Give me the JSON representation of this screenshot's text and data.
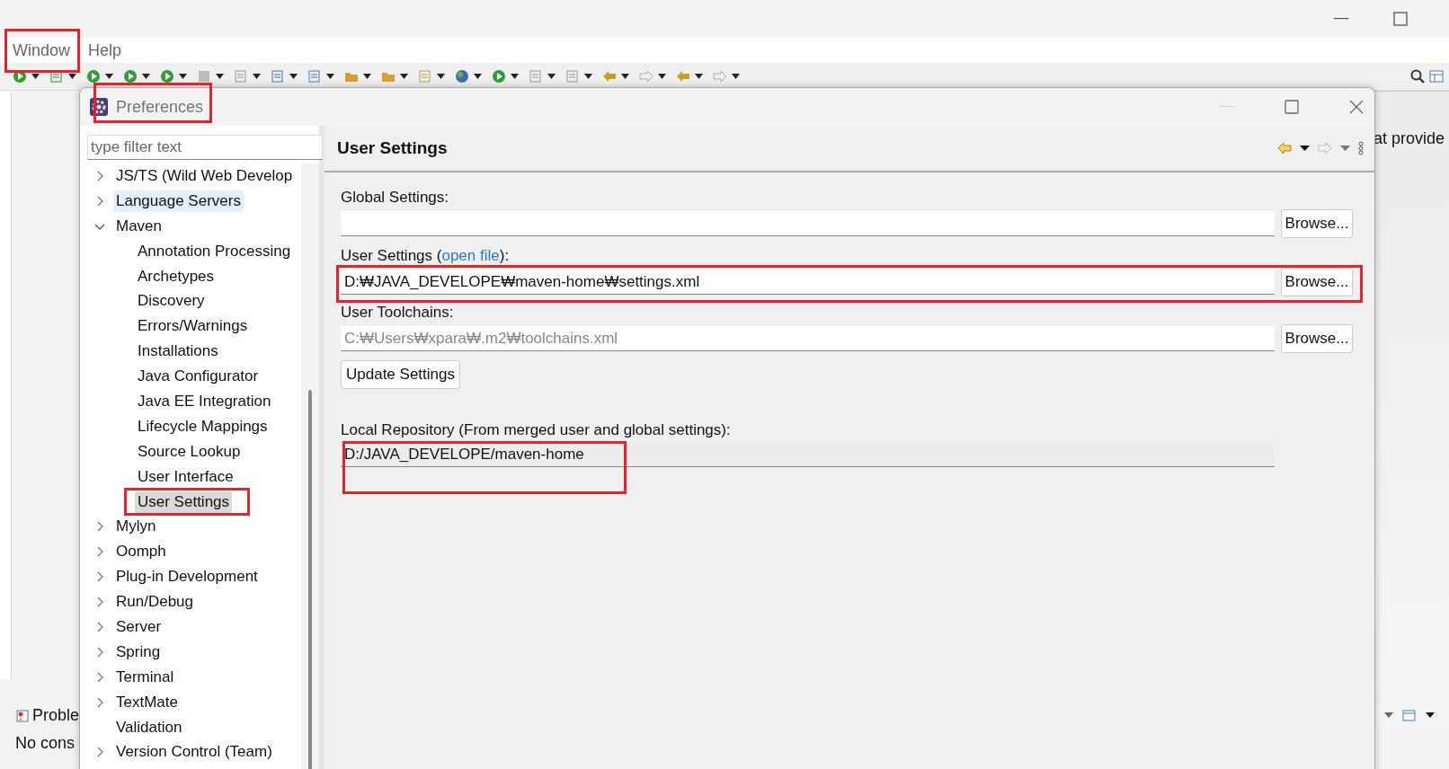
{
  "menu": [
    {
      "label": "Window"
    },
    {
      "label": "Help"
    }
  ],
  "background": {
    "right_text": "at provide",
    "problems_tab": "Proble",
    "console_text": "No cons"
  },
  "dialog": {
    "title": "Preferences",
    "filter": {
      "placeholder": "type filter text"
    },
    "tree": [
      {
        "label": "JS/TS (Wild Web Develop",
        "kind": "group",
        "expanded": false,
        "selected": false,
        "hovered": false
      },
      {
        "label": "Language Servers",
        "kind": "group",
        "expanded": false,
        "selected": false,
        "hovered": true
      },
      {
        "label": "Maven",
        "kind": "group",
        "expanded": true,
        "selected": false,
        "hovered": false,
        "children": [
          {
            "label": "Annotation Processing",
            "kind": "page",
            "selected": false,
            "hovered": false
          },
          {
            "label": "Archetypes",
            "kind": "page",
            "selected": false,
            "hovered": false
          },
          {
            "label": "Discovery",
            "kind": "page",
            "selected": false,
            "hovered": false
          },
          {
            "label": "Errors/Warnings",
            "kind": "page",
            "selected": false,
            "hovered": false
          },
          {
            "label": "Installations",
            "kind": "page",
            "selected": false,
            "hovered": false
          },
          {
            "label": "Java Configurator",
            "kind": "page",
            "selected": false,
            "hovered": false
          },
          {
            "label": "Java EE Integration",
            "kind": "page",
            "selected": false,
            "hovered": false
          },
          {
            "label": "Lifecycle Mappings",
            "kind": "page",
            "selected": false,
            "hovered": false
          },
          {
            "label": "Source Lookup",
            "kind": "page",
            "selected": false,
            "hovered": false
          },
          {
            "label": "User Interface",
            "kind": "page",
            "selected": false,
            "hovered": false
          },
          {
            "label": "User Settings",
            "kind": "page",
            "selected": true,
            "hovered": false
          }
        ]
      },
      {
        "label": "Mylyn",
        "kind": "group",
        "expanded": false,
        "selected": false,
        "hovered": false
      },
      {
        "label": "Oomph",
        "kind": "group",
        "expanded": false,
        "selected": false,
        "hovered": false
      },
      {
        "label": "Plug-in Development",
        "kind": "group",
        "expanded": false,
        "selected": false,
        "hovered": false
      },
      {
        "label": "Run/Debug",
        "kind": "group",
        "expanded": false,
        "selected": false,
        "hovered": false
      },
      {
        "label": "Server",
        "kind": "group",
        "expanded": false,
        "selected": false,
        "hovered": false
      },
      {
        "label": "Spring",
        "kind": "group",
        "expanded": false,
        "selected": false,
        "hovered": false
      },
      {
        "label": "Terminal",
        "kind": "group",
        "expanded": false,
        "selected": false,
        "hovered": false
      },
      {
        "label": "TextMate",
        "kind": "group",
        "expanded": false,
        "selected": false,
        "hovered": false
      },
      {
        "label": "Validation",
        "kind": "page",
        "selected": false,
        "hovered": false
      },
      {
        "label": "Version Control (Team)",
        "kind": "group",
        "expanded": false,
        "selected": false,
        "hovered": false
      }
    ],
    "page": {
      "title": "User Settings",
      "global_settings": {
        "label": "Global Settings:",
        "button": "Browse..."
      },
      "user_settings": {
        "label": "User Settings (",
        "link": "open file",
        "label_end": "):",
        "value": "D:₩JAVA_DEVELOPE₩maven-home₩settings.xml",
        "button": "Browse..."
      },
      "toolchains": {
        "label": "User Toolchains:",
        "placeholder": "C:₩Users₩xpara₩.m2₩toolchains.xml",
        "button": "Browse..."
      },
      "update_button": "Update Settings",
      "local_repository": {
        "label": "Local Repository (From merged user and global settings):",
        "value": "D:/JAVA_DEVELOPE/maven-home"
      }
    }
  }
}
